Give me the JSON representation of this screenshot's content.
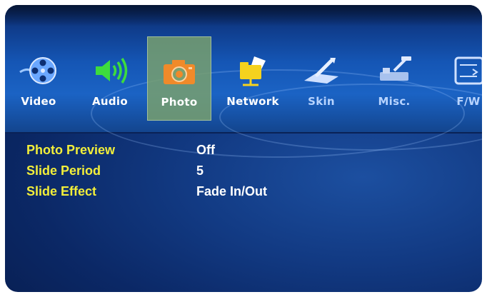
{
  "menu": {
    "items": [
      {
        "label": "Video",
        "icon": "film-reel-icon"
      },
      {
        "label": "Audio",
        "icon": "speaker-icon"
      },
      {
        "label": "Photo",
        "icon": "camera-icon",
        "selected": true
      },
      {
        "label": "Network",
        "icon": "network-folder-icon"
      },
      {
        "label": "Skin",
        "icon": "brush-icon"
      },
      {
        "label": "Misc.",
        "icon": "tools-icon"
      },
      {
        "label": "F/W",
        "icon": "firmware-icon"
      }
    ]
  },
  "settings": [
    {
      "label": "Photo Preview",
      "value": "Off"
    },
    {
      "label": "Slide Period",
      "value": "5"
    },
    {
      "label": "Slide Effect",
      "value": "Fade In/Out"
    }
  ],
  "colors": {
    "label": "#f2ee3a",
    "value": "#ffffff",
    "selected_bg": "#789e6e",
    "camera_orange": "#f08a2a",
    "audio_green": "#3ddc3d"
  }
}
